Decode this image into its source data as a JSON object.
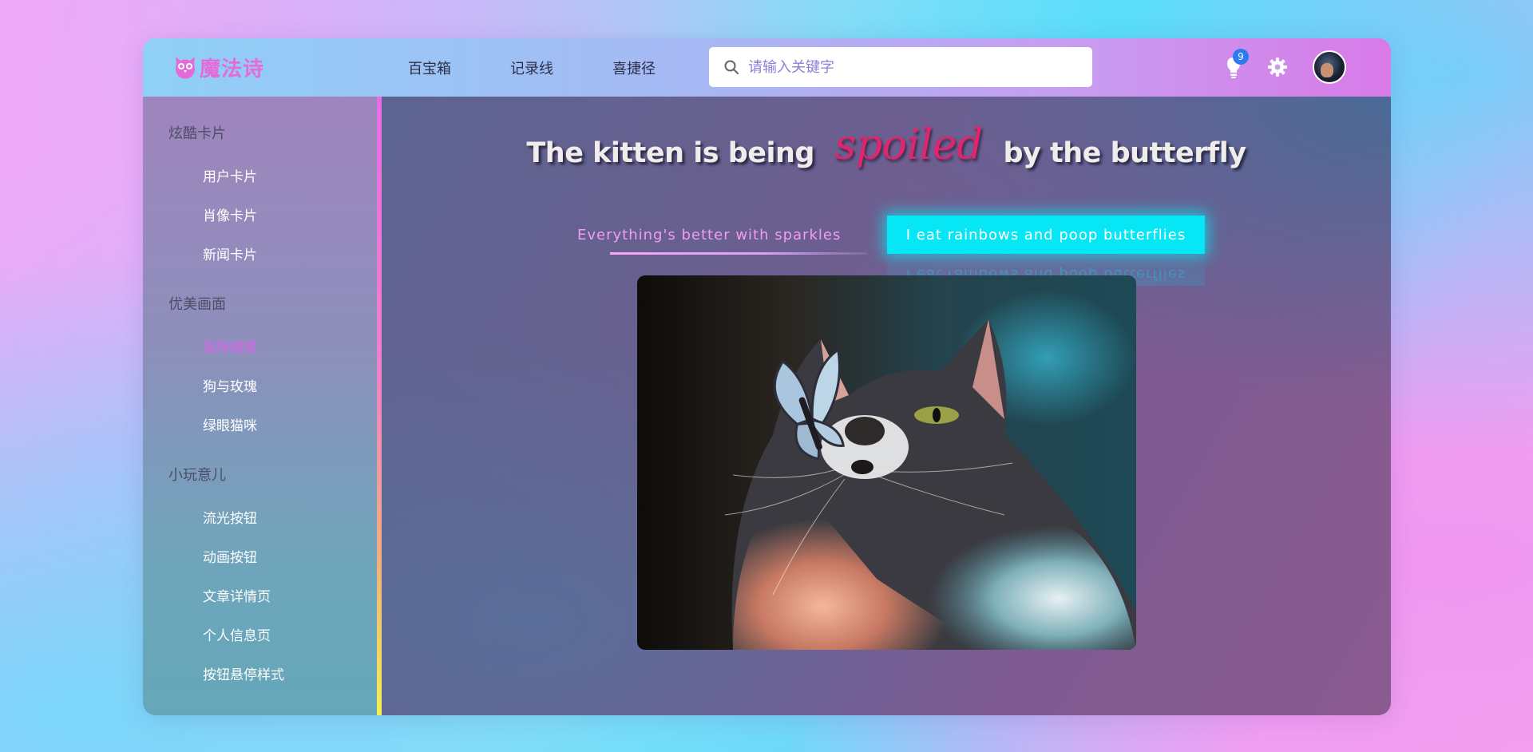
{
  "header": {
    "logo_text": "魔法诗",
    "nav": [
      "百宝箱",
      "记录线",
      "喜捷径"
    ],
    "search_placeholder": "请输入关键字",
    "notification_count": "9"
  },
  "sidebar": {
    "groups": [
      {
        "title": "炫酷卡片",
        "items": [
          "用户卡片",
          "肖像卡片",
          "新闻卡片"
        ]
      },
      {
        "title": "优美画面",
        "items": [
          "猫咪蝴蝶",
          "狗与玫瑰",
          "绿眼猫咪"
        ]
      },
      {
        "title": "小玩意儿",
        "items": [
          "流光按钮",
          "动画按钮",
          "文章详情页",
          "个人信息页",
          "按钮悬停样式"
        ]
      }
    ],
    "active_item": "猫咪蝴蝶"
  },
  "main": {
    "headline_part1": "The kitten is being",
    "headline_highlight": "spoiled",
    "headline_part2": "by the butterfly",
    "tab_left": "Everything's better with sparkles",
    "tab_right": "I eat rainbows and poop butterflies"
  },
  "status_bar": {
    "url": "localhost:8080/#"
  },
  "colors": {
    "accent_pink": "#e46bd8",
    "highlight_red": "#e0246d",
    "active_cyan": "#06e6f4",
    "badge_blue": "#2d7bf0"
  }
}
